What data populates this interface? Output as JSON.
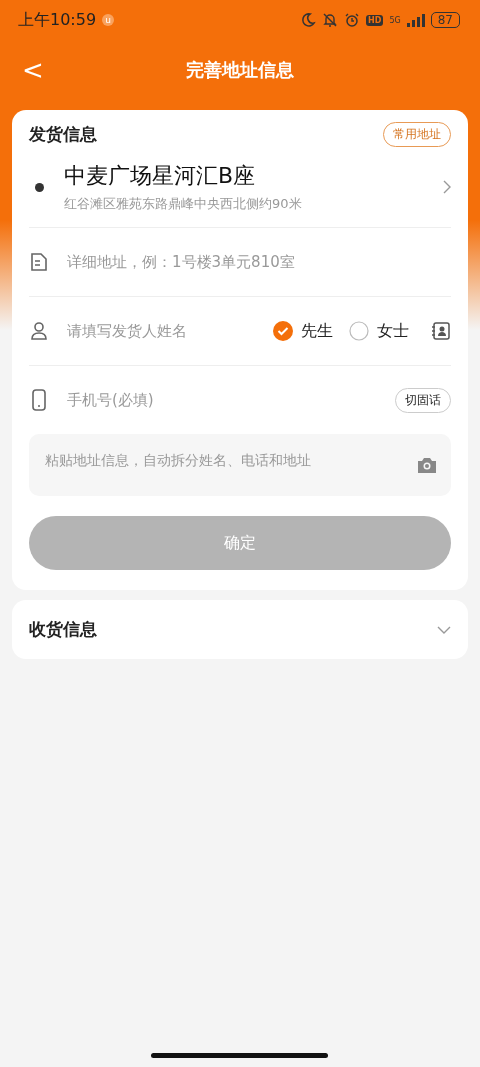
{
  "status_bar": {
    "time": "上午10:59",
    "notice_badge": "u",
    "hd_label": "HD",
    "network": "5G",
    "battery": "87"
  },
  "header": {
    "back": "<",
    "title": "完善地址信息"
  },
  "sender": {
    "title": "发货信息",
    "common_address_button": "常用地址",
    "location": {
      "name": "中麦广场星河汇B座",
      "detail": "红谷滩区雅苑东路鼎峰中央西北侧约90米"
    },
    "detail_address": {
      "placeholder": "详细地址，例：1号楼3单元810室"
    },
    "name": {
      "placeholder": "请填写发货人姓名"
    },
    "genders": [
      {
        "label": "先生",
        "selected": true
      },
      {
        "label": "女士",
        "selected": false
      }
    ],
    "phone": {
      "placeholder": "手机号(必填)",
      "switch_button": "切固话"
    },
    "paste": {
      "placeholder": "粘贴地址信息，自动拆分姓名、电话和地址"
    },
    "confirm": {
      "label": "确定",
      "disabled": true
    }
  },
  "receiver": {
    "title": "收货信息",
    "expanded": false
  }
}
